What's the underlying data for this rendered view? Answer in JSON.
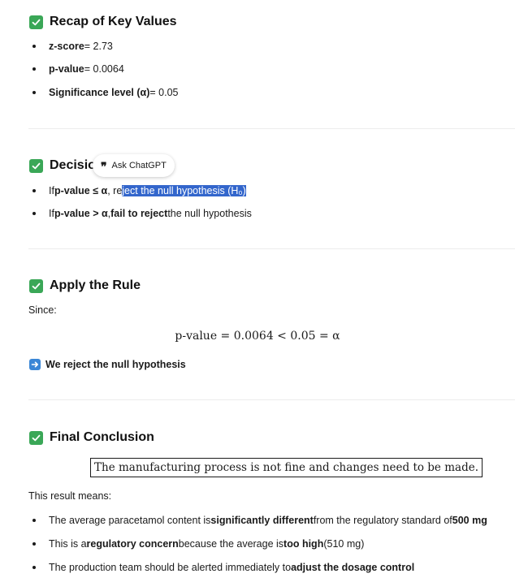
{
  "recap": {
    "title": "Recap of Key Values",
    "items": [
      {
        "label": "z-score",
        "value": " = 2.73"
      },
      {
        "label": "p-value",
        "value": " = 0.0064"
      },
      {
        "label": "Significance level (α)",
        "value": " = 0.05"
      }
    ]
  },
  "decision": {
    "title_visible": "Decisio",
    "rule1": {
      "pre": "If ",
      "bold": "p-value ≤ α",
      "mid": ", re",
      "highlighted": "ject the null hypothesis (H₀)"
    },
    "rule2": {
      "pre": "If ",
      "bold1": "p-value > α",
      "sep": ", ",
      "bold2": "fail to reject",
      "post": " the null hypothesis"
    }
  },
  "ask_popup": {
    "icon": "quote-icon",
    "label": "Ask ChatGPT"
  },
  "apply": {
    "title": "Apply the Rule",
    "since": "Since:",
    "equation": "p-value = 0.0064 < 0.05 = α",
    "conclusion_icon": "arrow-right-icon",
    "conclusion": "We reject the null hypothesis"
  },
  "final": {
    "title": "Final Conclusion",
    "boxed_statement": "The manufacturing process is not fine and changes need to be made.",
    "intro": "This result means:",
    "points": [
      {
        "a": "The average paracetamol content is ",
        "b": "significantly different",
        "c": " from the regulatory standard of ",
        "d": "500 mg",
        "e": ""
      },
      {
        "a": "This is a ",
        "b": "regulatory concern",
        "c": " because the average is ",
        "d": "too high",
        "e": " (510 mg)"
      },
      {
        "a": "The production team should be alerted immediately to ",
        "b": "adjust the dosage control",
        "c": "",
        "d": "",
        "e": ""
      }
    ]
  },
  "colors": {
    "check_icon": "#3aa757",
    "arrow_icon": "#3a86d6",
    "selection_highlight": "#3366cc"
  }
}
